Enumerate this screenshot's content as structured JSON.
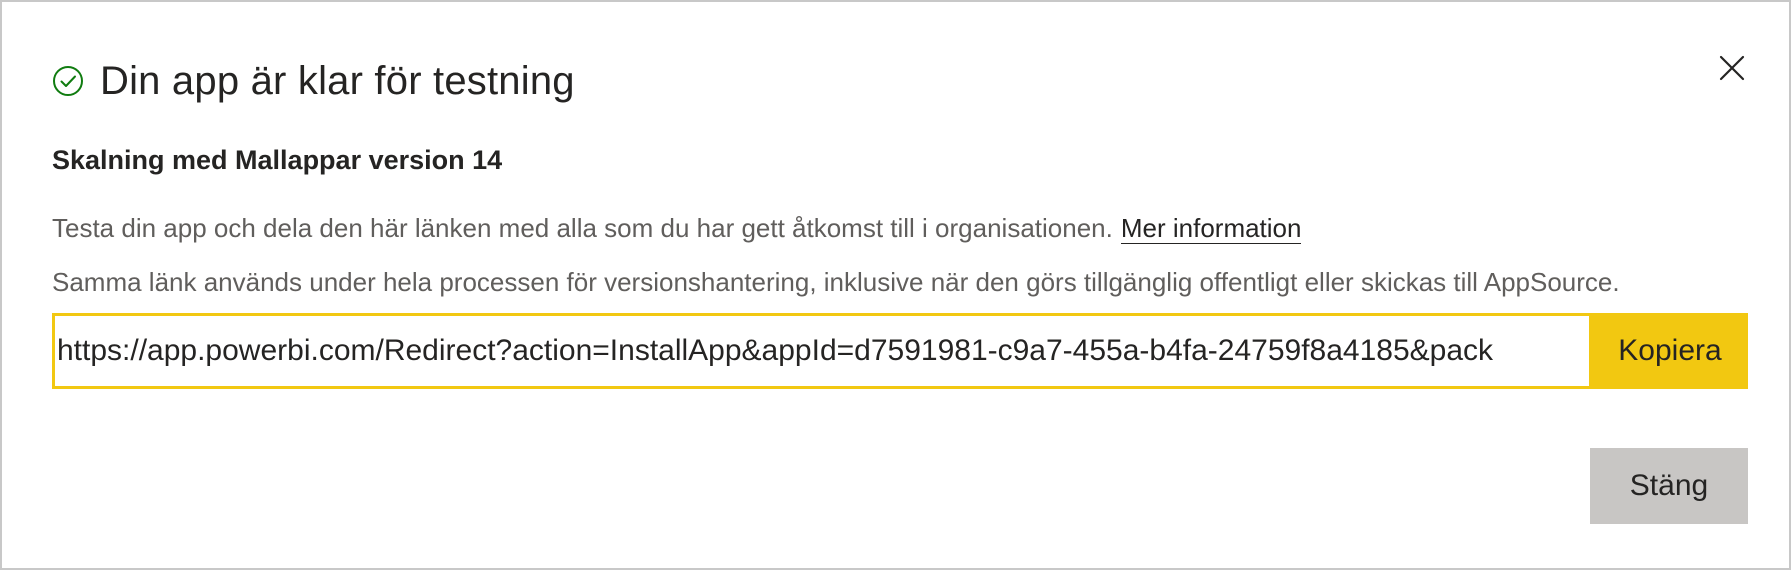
{
  "dialog": {
    "title": "Din app är klar för testning",
    "subtitle": "Skalning med Mallappar version 14",
    "description_line1": "Testa din app och dela den här länken med alla som du har gett åtkomst till i organisationen.",
    "more_info_link": "Mer information",
    "description_line2": "Samma länk används under hela processen för versionshantering, inklusive när den görs tillgänglig offentligt eller skickas till AppSource.",
    "url_value": "https://app.powerbi.com/Redirect?action=InstallApp&appId=d7591981-c9a7-455a-b4fa-24759f8a4185&pack",
    "copy_label": "Kopiera",
    "close_label": "Stäng"
  },
  "icons": {
    "status": "check-circle-icon",
    "close": "close-icon"
  },
  "colors": {
    "accent": "#f2c811",
    "success": "#107c10",
    "close_button_bg": "#c8c6c4",
    "text_primary": "#252423",
    "text_secondary": "#605e5c"
  }
}
